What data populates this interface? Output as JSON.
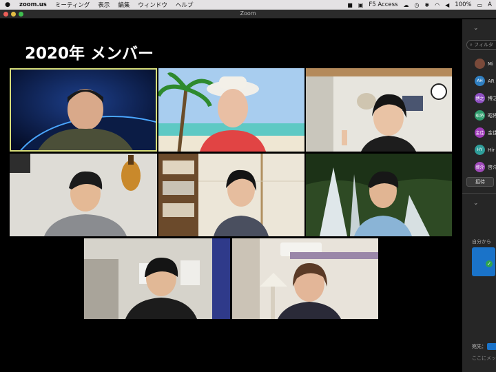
{
  "menubar": {
    "app": "zoom.us",
    "items": [
      "ミーティング",
      "表示",
      "編集",
      "ウィンドウ",
      "ヘルプ"
    ],
    "status_vpn": "F5 Access",
    "battery": "100%",
    "input": "A"
  },
  "window": {
    "title": "Zoom"
  },
  "gallery": {
    "title": "2020年 メンバー",
    "participants": [
      {
        "scene": "earth-space",
        "active": true
      },
      {
        "scene": "beach"
      },
      {
        "scene": "room-clock"
      },
      {
        "scene": "room-guitar"
      },
      {
        "scene": "room-shoji"
      },
      {
        "scene": "waterfall"
      },
      {
        "scene": "room-door"
      },
      {
        "scene": "room-lamp"
      }
    ]
  },
  "panel": {
    "search_placeholder": "フィルタ",
    "participants": [
      {
        "initials": "",
        "name": "Mi",
        "color": "#7a4a3a"
      },
      {
        "initials": "AH",
        "name": "AR",
        "color": "#2f7fc1"
      },
      {
        "initials": "博之",
        "name": "博之",
        "color": "#8e4fc2"
      },
      {
        "initials": "昭将",
        "name": "昭将",
        "color": "#2f9e6e"
      },
      {
        "initials": "金佳",
        "name": "金佳",
        "color": "#a03cba"
      },
      {
        "initials": "HY",
        "name": "Hir",
        "color": "#2f9e9a"
      },
      {
        "initials": "啓介",
        "name": "啓介",
        "color": "#a04aba"
      }
    ],
    "invite_label": "招待",
    "chat_from": "自分から",
    "send_to_label": "宛先：",
    "chat_placeholder": "ここにメッ"
  }
}
